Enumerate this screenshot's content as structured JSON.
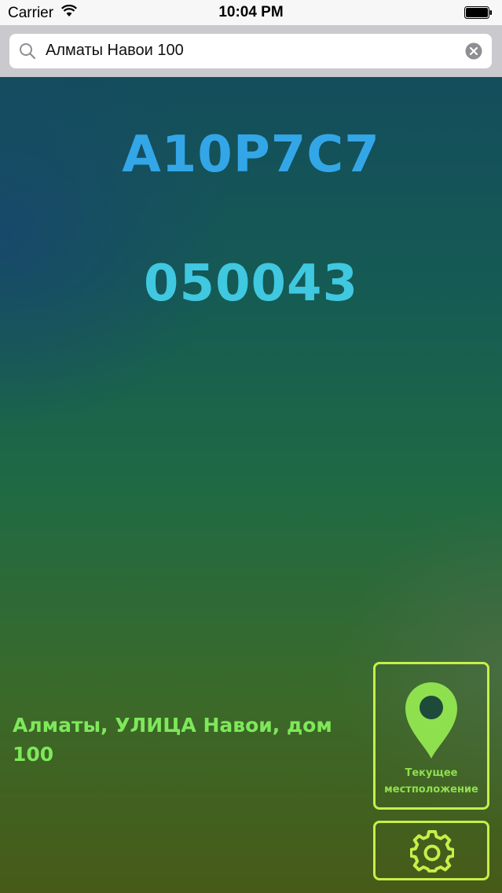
{
  "status_bar": {
    "carrier": "Carrier",
    "time": "10:04 PM"
  },
  "search": {
    "value": "Алматы Навои 100",
    "icon": "search-icon",
    "clear_icon": "clear-icon"
  },
  "result": {
    "code": "A10P7C7",
    "postal_code": "050043",
    "address": "Алматы, УЛИЦА Навои, дом 100"
  },
  "buttons": {
    "current_location_line1": "Текущее",
    "current_location_line2": "местположение",
    "current_location_icon": "location-pin-icon",
    "settings_icon": "gear-icon"
  },
  "colors": {
    "code": "#33a6e8",
    "postal_code": "#3fc8e0",
    "address": "#7ee85a",
    "button_border": "#c6ef4a",
    "pin": "#8fe04e"
  }
}
